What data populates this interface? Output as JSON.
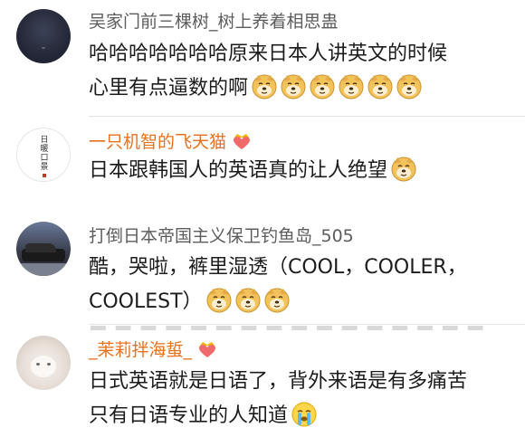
{
  "comments": [
    {
      "username": "吴家门前三棵树_树上养着相思蛊",
      "line1": "哈哈哈哈哈哈哈原来日本人讲英文的时候",
      "line2": "心里有点逼数的啊",
      "emoji_count": 6,
      "emoji": "doge-emoji"
    },
    {
      "username": "一只机智的飞天猫",
      "badge": "crown-heart-badge",
      "line1": "日本跟韩国人的英语真的让人绝望",
      "emoji": "doge-emoji",
      "avatar_text": "日暖口景"
    },
    {
      "username": "打倒日本帝国主义保卫钓鱼岛_505",
      "line1": "酷，哭啦，裤里湿透（COOL，COOLER，",
      "line2": "COOLEST）",
      "emoji_count": 3,
      "emoji": "doge-emoji"
    },
    {
      "username": "_茉莉拌海蜇_",
      "badge": "crown-heart-badge",
      "line1": "日式英语就是日语了，背外来语是有多痛苦",
      "line2": "只有日语专业的人知道",
      "emoji": "sob-emoji"
    }
  ],
  "colors": {
    "username_gray": "#5c5c5c",
    "username_orange": "#e8711c",
    "divider": "#e3e3e3"
  }
}
